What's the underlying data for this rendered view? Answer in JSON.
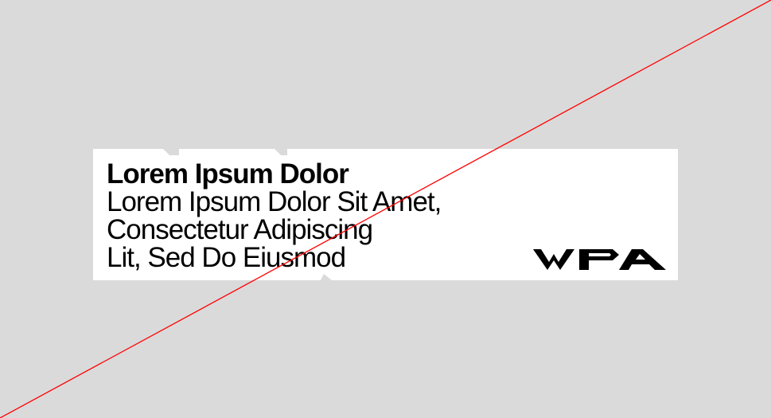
{
  "card": {
    "headline": "Lorem Ipsum Dolor",
    "lines": [
      "Lorem Ipsum Dolor Sit Amet,",
      "Consectetur Adipiscing",
      "Lit, Sed Do Eiusmod"
    ],
    "logo_text": "WPA"
  },
  "colors": {
    "background": "#dadada",
    "card": "#ffffff",
    "text": "#000000",
    "diagonal_line": "#ff0000"
  }
}
